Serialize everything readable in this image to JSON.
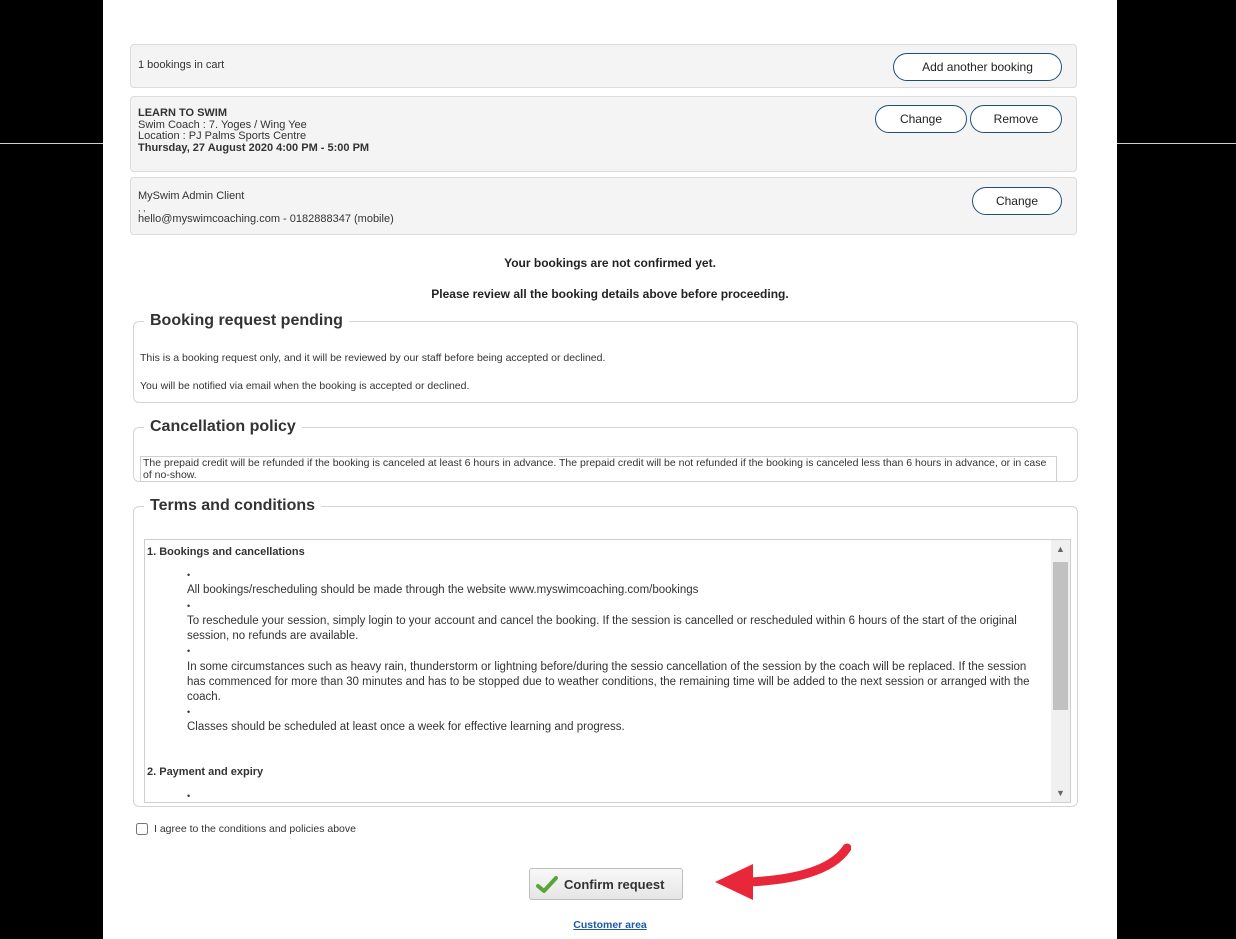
{
  "cart": {
    "summary": "1 bookings in cart",
    "add_button": "Add another booking"
  },
  "booking": {
    "title": "LEARN TO SWIM",
    "coach": "Swim Coach : 7. Yoges / Wing Yee",
    "location": "Location : PJ Palms Sports Centre",
    "datetime": "Thursday, 27 August 2020 4:00 PM - 5:00 PM",
    "change_button": "Change",
    "remove_button": "Remove"
  },
  "client": {
    "name": "MySwim Admin Client",
    "extra": ", ,",
    "contact": "hello@myswimcoaching.com - 0182888347 (mobile)",
    "change_button": "Change"
  },
  "notices": {
    "not_confirmed": "Your bookings are not confirmed yet.",
    "review": "Please review all the booking details above before proceeding."
  },
  "pending": {
    "heading": "Booking request pending",
    "line1": "This is a booking request only, and it will be reviewed by our staff before being accepted or declined.",
    "line2": "You will be notified via email when the booking is accepted or declined."
  },
  "cancellation": {
    "heading": "Cancellation policy",
    "text": "The prepaid credit will be refunded if the booking is canceled at least 6 hours in advance. The prepaid credit will be not refunded if the booking is canceled less than 6 hours in advance, or in case of no-show."
  },
  "terms": {
    "heading": "Terms and conditions",
    "section1_title": "1. Bookings and cancellations",
    "items": [
      "All bookings/rescheduling should be made through the website www.myswimcoaching.com/bookings",
      "To reschedule your session, simply login to your account and cancel the booking. If the session is cancelled or rescheduled within 6 hours of the start of the original session, no refunds are available.",
      "In some circumstances such as heavy rain, thunderstorm or lightning before/during the sessio cancellation of the session by the coach will be replaced. If the session has commenced for more than 30 minutes and has to be stopped due to weather conditions, the remaining time will be added to the next session or arranged with the coach.",
      "Classes should be scheduled at least once a week for effective learning and progress."
    ],
    "section2_title": "2. Payment and expiry"
  },
  "agree": {
    "label": "I agree to the conditions and policies above"
  },
  "confirm": {
    "label": "Confirm request"
  },
  "footer": {
    "customer_area": "Customer area"
  },
  "colors": {
    "arrow": "#e8283a",
    "button_border": "#1e4e79",
    "link": "#1a5aa6"
  }
}
